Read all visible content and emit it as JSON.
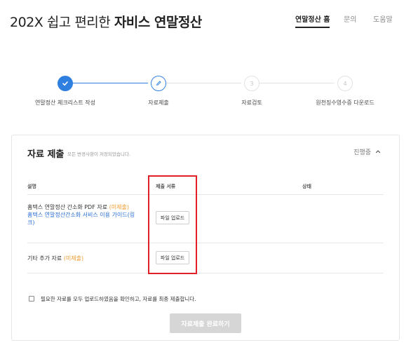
{
  "header": {
    "title_light": "202X 쉽고 편리한 ",
    "title_bold": "자비스 연말정산",
    "nav": [
      "연말정산 홈",
      "문의",
      "도움말"
    ]
  },
  "stepper": {
    "steps": [
      {
        "label": "연말정산 체크리스트 작성",
        "state": "done"
      },
      {
        "label": "자료제출",
        "state": "current"
      },
      {
        "label": "자료검토",
        "state": "todo",
        "num": "3"
      },
      {
        "label": "원천징수영수증 다운로드",
        "state": "todo",
        "num": "4"
      }
    ]
  },
  "card": {
    "title": "자료 제출",
    "subtitle": "모든 변경사항이 저장되었습니다.",
    "status": "진행중",
    "columns": [
      "설명",
      "제출 서류",
      "상태"
    ],
    "rows": [
      {
        "desc": "홈택스 연말정산 간소화 PDF 자료",
        "badge": "(미제출)",
        "link": "홈택스 연말정산간소화 서비스 이용 가이드(링크)",
        "button": "파일 업로드"
      },
      {
        "desc": "기타 추가 자료",
        "badge": "(미제출)",
        "button": "파일 업로드"
      }
    ],
    "agree": "필요한 자료를 모두 업로드하였음을 확인하고, 자료를 최종 제출합니다.",
    "submit": "자료제출 완료하기"
  },
  "colors": {
    "accent": "#2f7fe0",
    "highlight": "#e21e26",
    "badge": "#f29a2e",
    "link": "#2a6fd6"
  }
}
